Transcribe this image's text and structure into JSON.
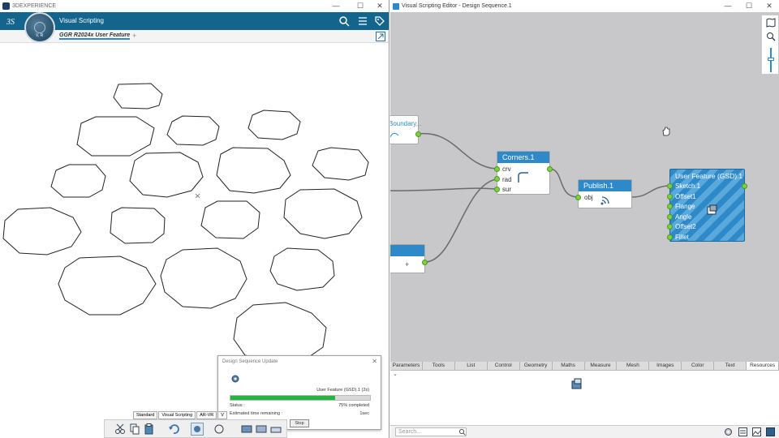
{
  "left_window": {
    "title": "3DEXPERIENCE",
    "app_name": "Visual Scripting",
    "compass_label": "V, R",
    "tab_label": "GGR R2024x User Feature",
    "add_tab": "+",
    "controls": [
      "—",
      "☐",
      "✕"
    ]
  },
  "right_window": {
    "title": "Visual Scripting Editor - Design Sequence.1",
    "controls": [
      "—",
      "☐",
      "✕"
    ]
  },
  "nodes": {
    "boundary": {
      "title": "Boundary..."
    },
    "corners": {
      "title": "Corners.1",
      "ports": [
        "crv",
        "rad",
        "sur"
      ]
    },
    "publish": {
      "title": "Publish.1",
      "ports": [
        "obj"
      ]
    },
    "user_feature": {
      "title": "User Feature (GSD).1",
      "ports": [
        "Sketch.1",
        "Offset1",
        "Flange",
        "Angle",
        "Offset2",
        "Fillet"
      ]
    },
    "partial_node": {
      "plus": "+"
    }
  },
  "palette": {
    "tabs": [
      "Parameters",
      "Tools",
      "List",
      "Control",
      "Geometry",
      "Maths",
      "Measure",
      "Mesh",
      "Images",
      "Color",
      "Text",
      "Resources"
    ],
    "active_tab": "Resources",
    "search_placeholder": "Search..."
  },
  "dialog": {
    "title": "Design Sequence Update",
    "item": "User Feature (GSD).1 (2s)",
    "status_label": "Status :",
    "status_value": "75% completed",
    "progress": 0.75,
    "remaining_label": "Estimated time remaining :",
    "remaining_value": "1sec",
    "stop_label": "Stop"
  },
  "bottom_tabs": [
    "Standard",
    "Visual Scripting",
    "AR-VR",
    "V"
  ],
  "colors": {
    "app_blue": "#14658d",
    "node_header": "#2e89c8",
    "port_green": "#7bd13f",
    "progress_green": "#22b540",
    "canvas_gray": "#c8c8ca"
  }
}
